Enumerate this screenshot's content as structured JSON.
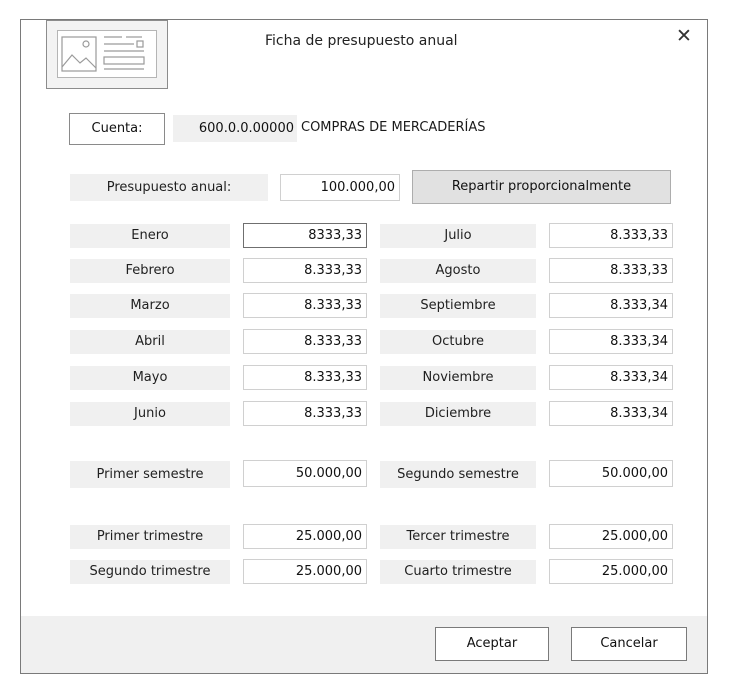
{
  "window": {
    "title": "Ficha de presupuesto anual",
    "close_label": "✕"
  },
  "cuenta": {
    "label": "Cuenta:",
    "code": "600.0.0.00000",
    "name": "COMPRAS DE MERCADERÍAS"
  },
  "presupuesto": {
    "label": "Presupuesto anual:",
    "value": "100.000,00",
    "button": "Repartir proporcionalmente"
  },
  "months_left": [
    {
      "label": "Enero",
      "value": "8333,33"
    },
    {
      "label": "Febrero",
      "value": "8.333,33"
    },
    {
      "label": "Marzo",
      "value": "8.333,33"
    },
    {
      "label": "Abril",
      "value": "8.333,33"
    },
    {
      "label": "Mayo",
      "value": "8.333,33"
    },
    {
      "label": "Junio",
      "value": "8.333,33"
    }
  ],
  "months_right": [
    {
      "label": "Julio",
      "value": "8.333,33"
    },
    {
      "label": "Agosto",
      "value": "8.333,33"
    },
    {
      "label": "Septiembre",
      "value": "8.333,34"
    },
    {
      "label": "Octubre",
      "value": "8.333,34"
    },
    {
      "label": "Noviembre",
      "value": "8.333,34"
    },
    {
      "label": "Diciembre",
      "value": "8.333,34"
    }
  ],
  "semestres": [
    {
      "label": "Primer semestre",
      "value": "50.000,00"
    },
    {
      "label": "Segundo semestre",
      "value": "50.000,00"
    }
  ],
  "trimestres": [
    {
      "label": "Primer trimestre",
      "value": "25.000,00"
    },
    {
      "label": "Tercer trimestre",
      "value": "25.000,00"
    },
    {
      "label": "Segundo trimestre",
      "value": "25.000,00"
    },
    {
      "label": "Cuarto trimestre",
      "value": "25.000,00"
    }
  ],
  "footer": {
    "accept": "Aceptar",
    "cancel": "Cancelar"
  }
}
